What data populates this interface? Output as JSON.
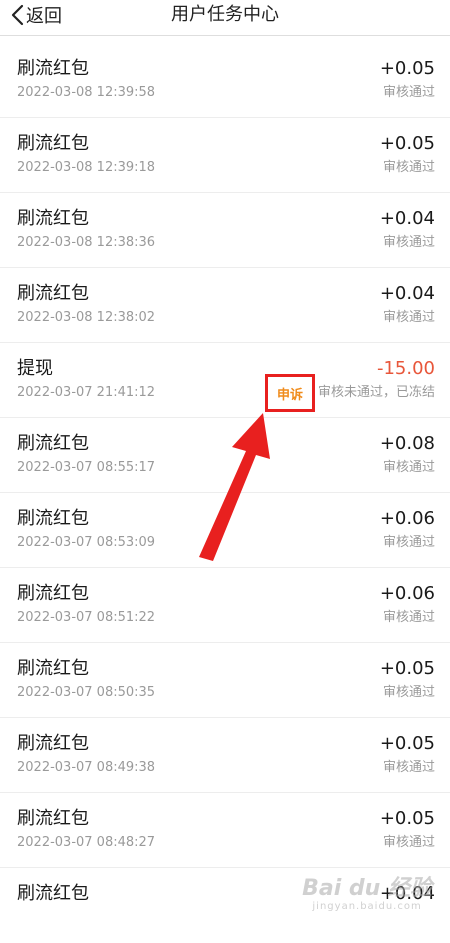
{
  "header": {
    "back_label": "返回",
    "title": "用户任务中心"
  },
  "records": [
    {
      "name": "刷流红包",
      "time": "2022-03-08 12:39:58",
      "amount": "+0.05",
      "status": "审核通过"
    },
    {
      "name": "刷流红包",
      "time": "2022-03-08 12:39:18",
      "amount": "+0.05",
      "status": "审核通过"
    },
    {
      "name": "刷流红包",
      "time": "2022-03-08 12:38:36",
      "amount": "+0.04",
      "status": "审核通过"
    },
    {
      "name": "刷流红包",
      "time": "2022-03-08 12:38:02",
      "amount": "+0.04",
      "status": "审核通过"
    },
    {
      "name": "提现",
      "time": "2022-03-07 21:41:12",
      "amount": "-15.00",
      "status": "审核未通过，已冻结",
      "appeal_label": "申诉"
    },
    {
      "name": "刷流红包",
      "time": "2022-03-07 08:55:17",
      "amount": "+0.08",
      "status": "审核通过"
    },
    {
      "name": "刷流红包",
      "time": "2022-03-07 08:53:09",
      "amount": "+0.06",
      "status": "审核通过"
    },
    {
      "name": "刷流红包",
      "time": "2022-03-07 08:51:22",
      "amount": "+0.06",
      "status": "审核通过"
    },
    {
      "name": "刷流红包",
      "time": "2022-03-07 08:50:35",
      "amount": "+0.05",
      "status": "审核通过"
    },
    {
      "name": "刷流红包",
      "time": "2022-03-07 08:49:38",
      "amount": "+0.05",
      "status": "审核通过"
    },
    {
      "name": "刷流红包",
      "time": "2022-03-07 08:48:27",
      "amount": "+0.05",
      "status": "审核通过"
    },
    {
      "name": "刷流红包",
      "amount": "+0.04"
    }
  ],
  "colors": {
    "negative_amount": "#e8563a",
    "appeal_text": "#f08c1c",
    "highlight_box": "#e8201f",
    "arrow": "#e8201f"
  },
  "watermark": {
    "main": "Bai du 经验",
    "sub": "jingyan.baidu.com"
  }
}
